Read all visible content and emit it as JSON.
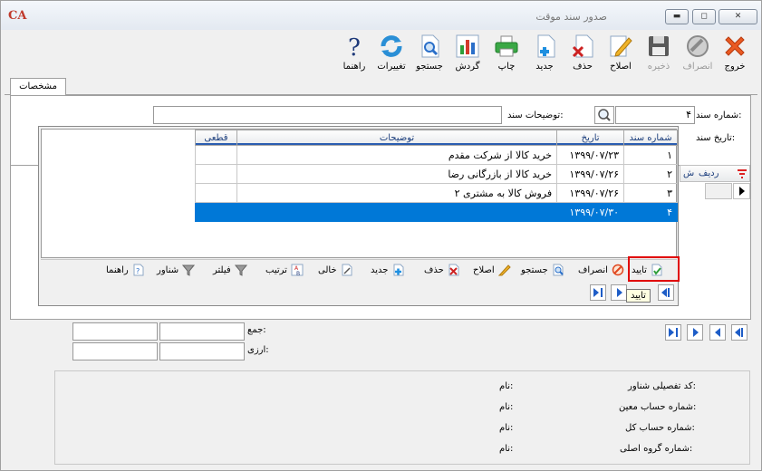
{
  "window": {
    "logo": "CA",
    "title": "صدور سند موقت",
    "minimize": "▬",
    "maximize": "◻",
    "close": "✕"
  },
  "toolbar": [
    {
      "id": "exit",
      "label": "خروج",
      "icon": "red-x-icon",
      "enabled": true,
      "color": "#e0461e"
    },
    {
      "id": "cancel",
      "label": "انصراف",
      "icon": "cancel-icon",
      "enabled": false,
      "color": "#8a8a8a"
    },
    {
      "id": "save",
      "label": "ذخیره",
      "icon": "disk-icon",
      "enabled": false,
      "color": "#555555"
    },
    {
      "id": "edit",
      "label": "اصلاح",
      "icon": "pencil-icon",
      "enabled": true,
      "color": "#e7a21b"
    },
    {
      "id": "delete",
      "label": "حذف",
      "icon": "delete-doc-icon",
      "enabled": true,
      "color": "#cc2222"
    },
    {
      "id": "new",
      "label": "جدید",
      "icon": "new-doc-icon",
      "enabled": true,
      "color": "#1e8fe0"
    },
    {
      "id": "print",
      "label": "چاپ",
      "icon": "printer-icon",
      "enabled": true,
      "color": "#2e9e3a"
    },
    {
      "id": "turnover",
      "label": "گردش",
      "icon": "chart-icon",
      "enabled": true,
      "color": "#d33a2c"
    },
    {
      "id": "search",
      "label": "جستجو",
      "icon": "search-doc-icon",
      "enabled": true,
      "color": "#2a6fc9"
    },
    {
      "id": "changes",
      "label": "تغییرات",
      "icon": "refresh-icon",
      "enabled": true,
      "color": "#2a8fd6"
    },
    {
      "id": "help",
      "label": "راهنما",
      "icon": "question-icon",
      "enabled": true,
      "color": "#1f3a7a"
    }
  ],
  "tab": {
    "label": "مشخصات"
  },
  "form": {
    "doc_number_label": "شماره سند:",
    "doc_number_value": "۴",
    "doc_date_label": "تاریخ سند:",
    "description_label": "توضیحات سند:",
    "description_value": ""
  },
  "popup": {
    "columns": {
      "doc_no": "شماره سند",
      "date": "تاریخ",
      "desc": "توضیحات",
      "final": "قطعی"
    },
    "rows": [
      {
        "doc_no": "۱",
        "date": "۱۳۹۹/۰۷/۲۳",
        "desc": "خرید کالا از شرکت مقدم",
        "final": "",
        "selected": false
      },
      {
        "doc_no": "۲",
        "date": "۱۳۹۹/۰۷/۲۶",
        "desc": "خرید کالا از بازرگانی رضا",
        "final": "",
        "selected": false
      },
      {
        "doc_no": "۳",
        "date": "۱۳۹۹/۰۷/۲۶",
        "desc": "فروش کالا به مشتری ۲",
        "final": "",
        "selected": false
      },
      {
        "doc_no": "۴",
        "date": "۱۳۹۹/۰۷/۳۰",
        "desc": "",
        "final": "",
        "selected": true
      }
    ],
    "toolbar": {
      "confirm": "تایید",
      "cancel": "انصراف",
      "search": "جستجو",
      "edit": "اصلاح",
      "delete": "حذف",
      "new": "جدید",
      "empty": "خالی",
      "sort": "ترتیب",
      "filter": "فیلتر",
      "float": "شناور",
      "help": "راهنما"
    },
    "tooltip": "تایید"
  },
  "back_grid": {
    "row_col": "ردیف",
    "partial_col": "ش"
  },
  "totals": {
    "sum_label": "جمع:",
    "currency_label": "ارزی:"
  },
  "footer": {
    "detail_label": "کد تفصیلی شناور:",
    "moein_label": "شماره حساب معین:",
    "kol_label": "شماره حساب کل:",
    "group_label": "شماره گروه اصلی:",
    "name_label": "نام:"
  },
  "colors": {
    "selection": "#0078d7",
    "highlight_border": "#e00000",
    "header_text": "#1a3d7c"
  }
}
